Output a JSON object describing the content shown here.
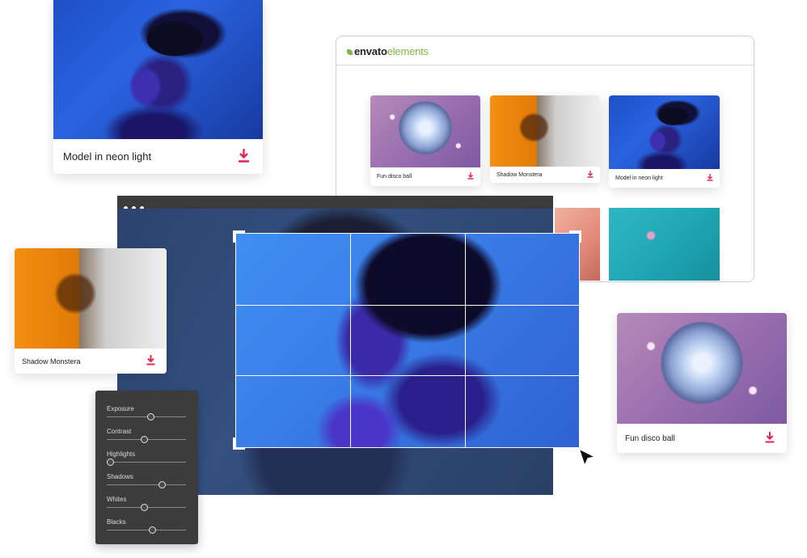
{
  "envato": {
    "logo_prefix": "envato",
    "logo_suffix": "elements",
    "brand_color": "#82b541",
    "items": [
      {
        "label": "Fun disco ball"
      },
      {
        "label": "Shadow Monstera"
      },
      {
        "label": "Model in neon light"
      }
    ]
  },
  "cards": {
    "model": {
      "label": "Model in neon light"
    },
    "monstera": {
      "label": "Shadow Monstera"
    },
    "disco": {
      "label": "Fun disco ball"
    }
  },
  "adjustments": {
    "sliders": [
      {
        "label": "Exposure",
        "value": 0.56
      },
      {
        "label": "Contrast",
        "value": 0.47
      },
      {
        "label": "Highlights",
        "value": 0.0
      },
      {
        "label": "Shadows",
        "value": 0.72
      },
      {
        "label": "Whites",
        "value": 0.47
      },
      {
        "label": "Blacks",
        "value": 0.58
      }
    ]
  },
  "colors": {
    "download_red": "#e0284f",
    "panel_bg": "#3c3c3c",
    "editor_titlebar": "#3b3b3b"
  },
  "icons": [
    "download-icon",
    "cursor-arrow-icon",
    "window-dots-icon"
  ]
}
